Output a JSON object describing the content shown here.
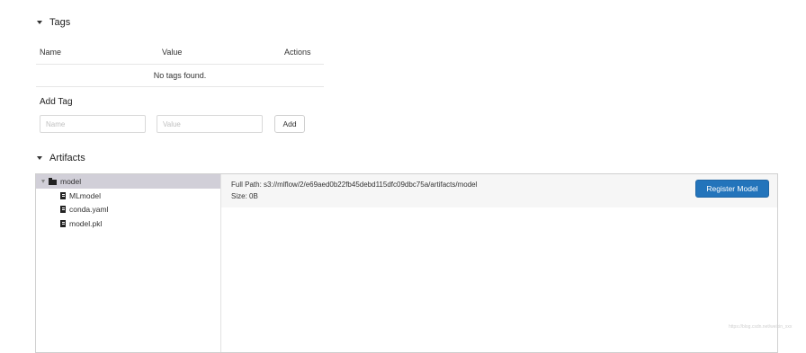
{
  "tags_section": {
    "title": "Tags",
    "columns": [
      "Name",
      "Value",
      "Actions"
    ],
    "empty_message": "No tags found."
  },
  "add_tag": {
    "label": "Add Tag",
    "name_placeholder": "Name",
    "value_placeholder": "Value",
    "button_label": "Add"
  },
  "artifacts_section": {
    "title": "Artifacts",
    "tree": {
      "folder": "model",
      "files": [
        "MLmodel",
        "conda.yaml",
        "model.pkl"
      ]
    },
    "full_path_label": "Full Path:",
    "full_path": "s3://mlflow/2/e69aed0b22fb45debd115dfc09dbc75a/artifacts/model",
    "size_label": "Size:",
    "size": "0B",
    "register_button": "Register Model"
  },
  "watermark": "https://blog.csdn.net/weixin_xxx"
}
